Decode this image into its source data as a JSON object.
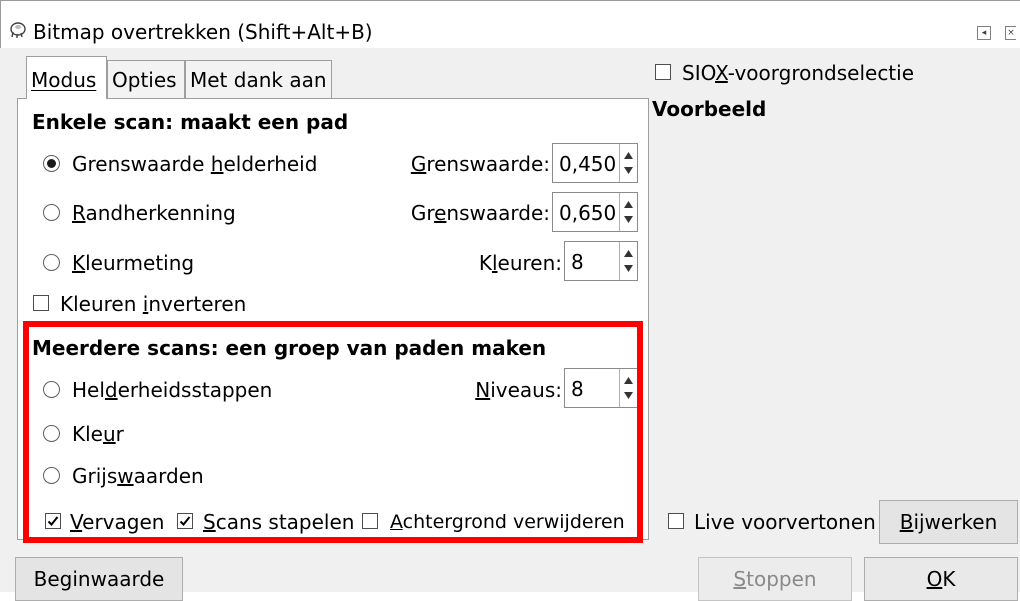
{
  "window": {
    "title": "Bitmap overtrekken (Shift+Alt+B)",
    "app_icon": "inkscape-icon",
    "restore_icon": "window-restore-icon",
    "close_icon": "window-close-icon"
  },
  "tabs": [
    {
      "label": "Modus",
      "active": true
    },
    {
      "label": "Opties",
      "active": false
    },
    {
      "label": "Met dank aan",
      "active": false
    }
  ],
  "single_scan": {
    "heading": "Enkele scan: maakt een pad",
    "options": [
      {
        "label": "Grenswaarde helderheid",
        "underline": "h",
        "selected": true,
        "field_label": "Grenswaarde:",
        "value": "0,450"
      },
      {
        "label": "Randherkenning",
        "underline": "R",
        "selected": false,
        "field_label": "Grenswaarde:",
        "value": "0,650"
      },
      {
        "label": "Kleurmeting",
        "underline": "K",
        "selected": false,
        "field_label": "Kleuren:",
        "value": "8"
      }
    ],
    "invert_label": "Kleuren inverteren",
    "invert_checked": false
  },
  "multi_scan": {
    "heading": "Meerdere scans: een groep van paden maken",
    "options": [
      {
        "label": "Helderheidsstappen",
        "selected": false,
        "field_label": "Niveaus:",
        "value": "8"
      },
      {
        "label": "Kleur",
        "selected": false
      },
      {
        "label": "Grijswaarden",
        "selected": false
      }
    ],
    "checks": [
      {
        "label": "Vervagen",
        "checked": true
      },
      {
        "label": "Scans stapelen",
        "checked": true
      },
      {
        "label": "Achtergrond verwijderen",
        "checked": false
      }
    ]
  },
  "right_panel": {
    "siox_label": "SIOX-voorgrondselectie",
    "siox_checked": false,
    "preview_heading": "Voorbeeld",
    "live_preview_label": "Live voorvertonen",
    "live_preview_checked": false,
    "update_button": "Bijwerken"
  },
  "footer": {
    "reset_button": "Beginwaarde",
    "stop_button": "Stoppen",
    "ok_button": "OK"
  },
  "colors": {
    "highlight_border": "#ff0000",
    "dialog_bg": "#f0f0f0",
    "panel_bg": "#ffffff"
  }
}
